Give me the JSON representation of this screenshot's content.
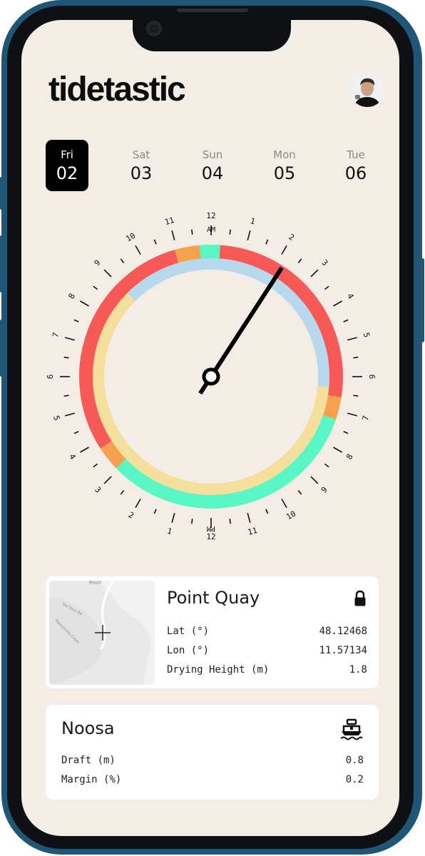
{
  "app": {
    "title": "tidetastic"
  },
  "days": [
    {
      "name": "Fri",
      "date": "02",
      "selected": true
    },
    {
      "name": "Sat",
      "date": "03",
      "selected": false
    },
    {
      "name": "Sun",
      "date": "04",
      "selected": false
    },
    {
      "name": "Mon",
      "date": "05",
      "selected": false
    },
    {
      "name": "Tue",
      "date": "06",
      "selected": false
    }
  ],
  "dial": {
    "am_label": "AM",
    "pm_label": "PM",
    "hour_labels": [
      "12",
      "1",
      "2",
      "3",
      "4",
      "5",
      "6",
      "7",
      "8",
      "9",
      "10",
      "11",
      "12",
      "1",
      "2",
      "3",
      "4",
      "5",
      "6",
      "7",
      "8",
      "9",
      "10",
      "11"
    ],
    "hand_time": "1:40 AM",
    "colors": {
      "green": "#58f7c5",
      "red": "#f75a56",
      "orange": "#f7a04d",
      "blue": "#b8d8ee",
      "yellow": "#f5df9d"
    }
  },
  "location_card": {
    "title": "Point Quay",
    "lock_icon": "lock-icon",
    "map_labels": [
      "Point",
      "Old Tram Rd",
      "Rawsonville Creek"
    ],
    "rows": [
      {
        "label": "Lat (°)",
        "value": "48.12468"
      },
      {
        "label": "Lon (°)",
        "value": "11.57134"
      },
      {
        "label": "Drying Height (m)",
        "value": "1.8"
      }
    ]
  },
  "vessel_card": {
    "title": "Noosa",
    "boat_icon": "boat-icon",
    "rows": [
      {
        "label": "Draft (m)",
        "value": "0.8"
      },
      {
        "label": "Margin (%)",
        "value": "0.2"
      }
    ]
  }
}
